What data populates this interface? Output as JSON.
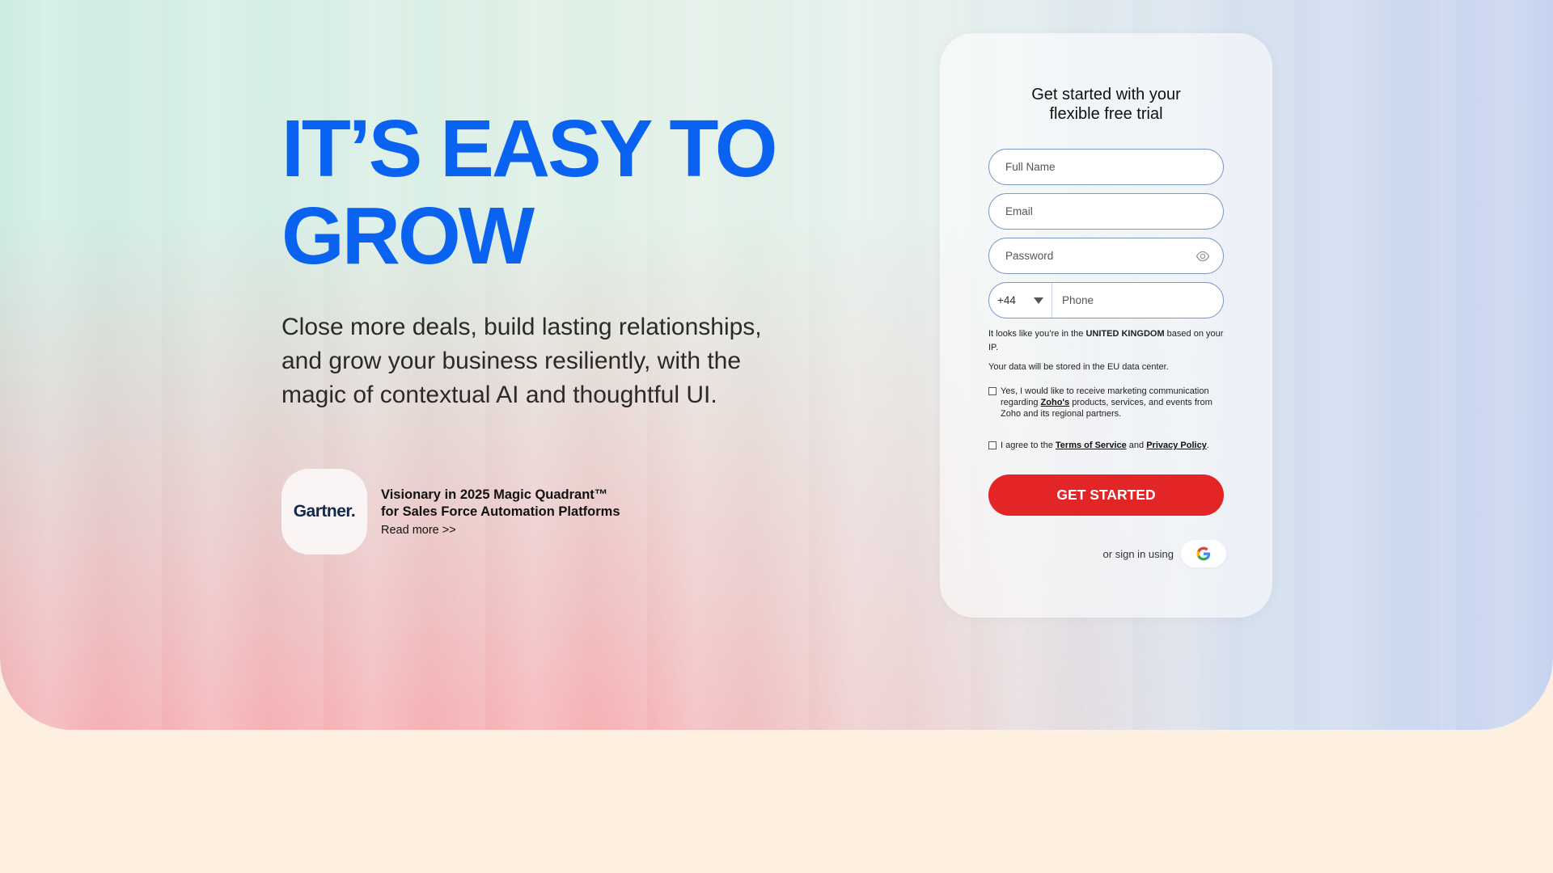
{
  "hero": {
    "headline_line1": "IT’S EASY TO",
    "headline_line2": "GROW",
    "subhead": "Close more deals, build lasting relationships, and grow your business resiliently, with the magic of contextual AI and thoughtful UI.",
    "gartner": {
      "logo_text": "Gartner.",
      "title_line1": "Visionary in 2025 Magic Quadrant™",
      "title_line2": "for Sales Force Automation Platforms",
      "link": "Read more >>"
    }
  },
  "signup": {
    "title_line1": "Get started with your",
    "title_line2": "flexible free trial",
    "full_name_placeholder": "Full Name",
    "email_placeholder": "Email",
    "password_placeholder": "Password",
    "country_code": "+44",
    "phone_placeholder": "Phone",
    "location_note_pre": "It looks like you’re in the ",
    "location_country": "UNITED KINGDOM",
    "location_note_post": " based on your IP.",
    "data_center_note": "Your data will be stored in the EU data center.",
    "marketing_pre": "Yes, I would like to receive marketing communication regarding ",
    "marketing_link": "Zoho's",
    "marketing_post": " products, services, and events from Zoho and its regional partners.",
    "terms_pre": "I agree to the ",
    "terms_link": "Terms of Service",
    "terms_mid": " and ",
    "privacy_link": "Privacy Policy",
    "terms_post": ".",
    "cta_label": "GET STARTED",
    "alt_sign_label": "or sign in using"
  },
  "colors": {
    "headline": "#0a63f0",
    "cta": "#e42527",
    "page_bottom": "#fdf0e0"
  }
}
